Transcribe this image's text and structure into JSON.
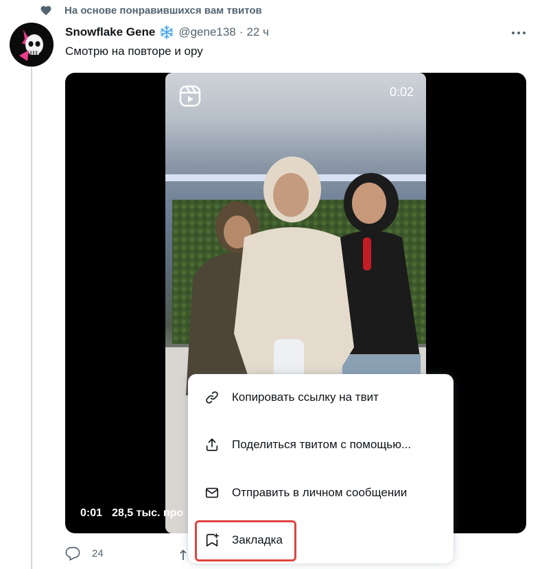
{
  "social_context": {
    "text": "На основе понравившихся вам твитов"
  },
  "tweet": {
    "author_name": "Snowflake Gene",
    "author_emoji": "snowflake-emoji",
    "handle": "@gene138",
    "separator": "·",
    "time": "22 ч",
    "text": "Смотрю на повторе и ору"
  },
  "video": {
    "duration": "0:02",
    "current_time": "0:01",
    "views": "28,5 тыс. про"
  },
  "actions": {
    "reply_count": "24"
  },
  "menu": {
    "items": [
      {
        "label": "Копировать ссылку на твит",
        "icon": "link-icon"
      },
      {
        "label": "Поделиться твитом с помощью...",
        "icon": "share-icon"
      },
      {
        "label": "Отправить в личном сообщении",
        "icon": "mail-icon"
      },
      {
        "label": "Закладка",
        "icon": "bookmark-add-icon"
      }
    ]
  },
  "colors": {
    "text_primary": "#0f1419",
    "text_secondary": "#536471",
    "highlight": "#e0443f",
    "thread_line": "#cfd9de"
  }
}
